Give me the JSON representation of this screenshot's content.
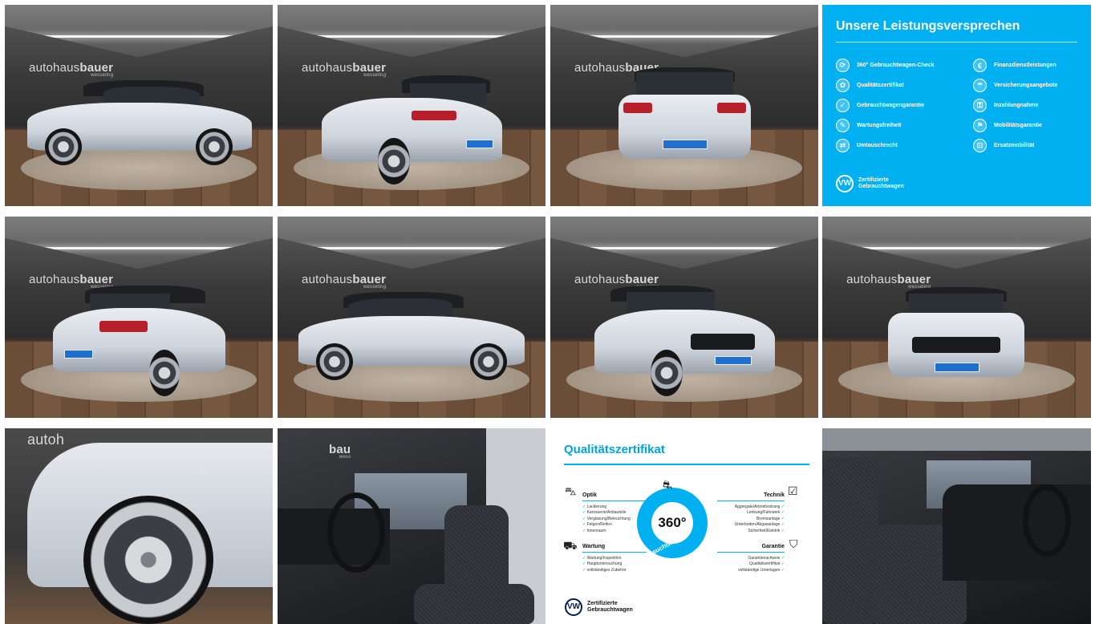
{
  "gallery": {
    "photos": [
      {
        "name": "photo-side-left",
        "brand": "autohaus",
        "brand_bold": "bauer",
        "brand_sub": "wesseling"
      },
      {
        "name": "photo-rear-left",
        "brand": "autohaus",
        "brand_bold": "bauer",
        "brand_sub": "wesseling"
      },
      {
        "name": "photo-rear",
        "brand": "autohaus",
        "brand_bold": "bauer",
        "brand_sub": "wesseling"
      },
      {
        "name": "photo-rear-left-2",
        "brand": "autohaus",
        "brand_bold": "bauer",
        "brand_sub": "wesseling"
      },
      {
        "name": "photo-side-right",
        "brand": "autohaus",
        "brand_bold": "bauer",
        "brand_sub": "wesseling"
      },
      {
        "name": "photo-front-left",
        "brand": "autohaus",
        "brand_bold": "bauer",
        "brand_sub": "wesseling"
      },
      {
        "name": "photo-front",
        "brand": "autohaus",
        "brand_bold": "bauer",
        "brand_sub": "wesseling"
      },
      {
        "name": "photo-wheel",
        "brand": "autoh",
        "brand_bold": "",
        "brand_sub": ""
      },
      {
        "name": "photo-interior-driver",
        "brand": "",
        "brand_bold": "bau",
        "brand_sub": "wess"
      },
      {
        "name": "photo-interior-passenger",
        "brand": "",
        "brand_bold": "",
        "brand_sub": ""
      }
    ]
  },
  "promise": {
    "title": "Unsere Leistungsversprechen",
    "left": [
      "360° Gebrauchtwagen-Check",
      "Qualitätszertifikat",
      "Gebrauchtwagengarantie",
      "Wartungsfreiheit",
      "Umtauschrecht"
    ],
    "right": [
      "Finanzdienstleistungen",
      "Versicherungsangebote",
      "Inzahlungnahme",
      "Mobilitätsgarantie",
      "Ersatzmobilität"
    ],
    "cert_line1": "Zertifizierte",
    "cert_line2": "Gebrauchtwagen"
  },
  "certificate": {
    "title": "Qualitätszertifikat",
    "optik": {
      "heading": "Optik",
      "items": [
        "Lackierung",
        "Karosserie/Anbauteile",
        "Verglasung/Beleuchtung",
        "Felgen/Reifen",
        "Innenraum"
      ]
    },
    "wartung": {
      "heading": "Wartung",
      "items": [
        "Wartung/Inspektion",
        "Hauptuntersuchung",
        "vollständiges Zubehör"
      ]
    },
    "technik": {
      "heading": "Technik",
      "items": [
        "Aggregate/Antriebsstrang",
        "Lenkung/Fahrwerk",
        "Bremsanlage",
        "Unterboden/Abgasanlage",
        "Sicherheit/Elektrik"
      ]
    },
    "garantie": {
      "heading": "Garantie",
      "items": [
        "Garantienachweis",
        "Qualitätszertifikat",
        "vollständige Unterlagen"
      ]
    },
    "badge_number": "360°",
    "badge_arc": "Gebrauchtwagen-Check",
    "cert_line1": "Zertifizierte",
    "cert_line2": "Gebrauchtwagen"
  },
  "colors": {
    "accent": "#00b0f0",
    "brand_blue": "#00a3e0",
    "car_white": "#e9edf2",
    "taillight": "#b7202a"
  }
}
